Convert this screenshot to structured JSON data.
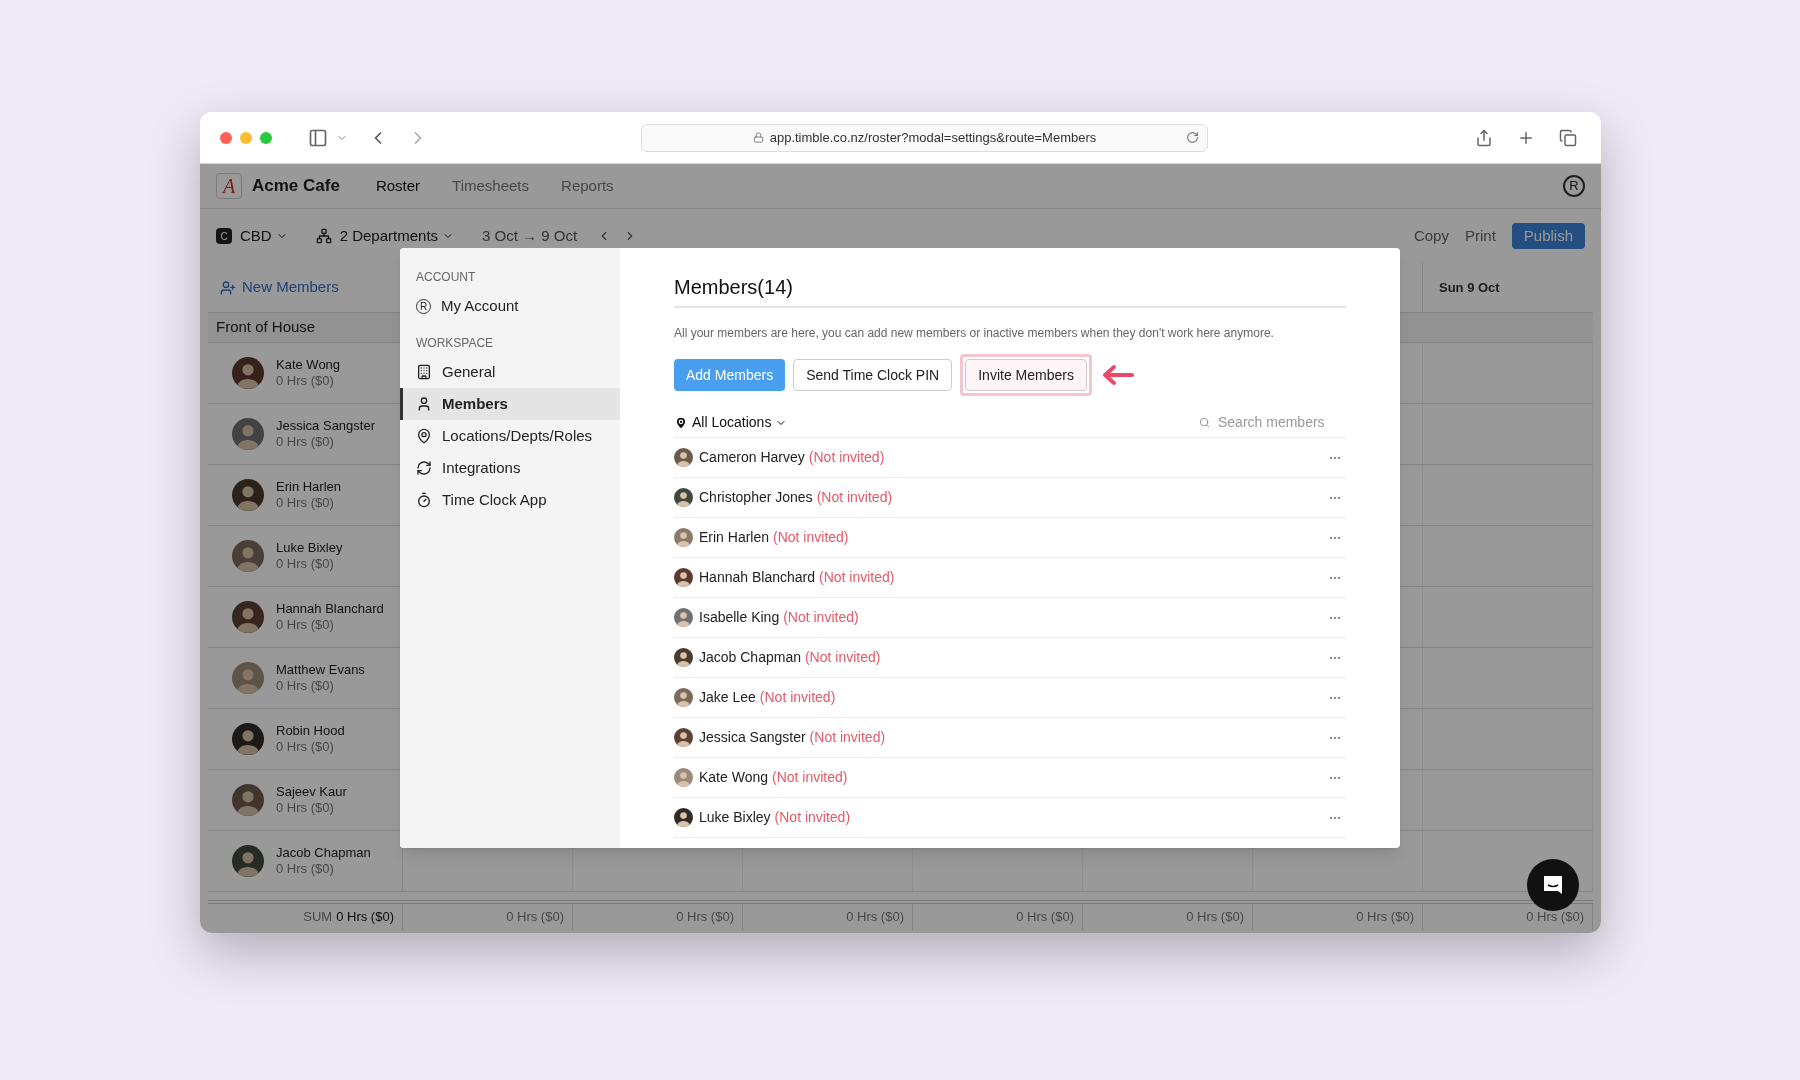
{
  "browser": {
    "url": "app.timble.co.nz/roster?modal=settings&route=Members"
  },
  "app": {
    "logo_letter": "A",
    "name": "Acme Cafe",
    "user_letter": "R",
    "nav": [
      {
        "label": "Roster",
        "selected": true
      },
      {
        "label": "Timesheets",
        "selected": false
      },
      {
        "label": "Reports",
        "selected": false
      }
    ]
  },
  "toolbar": {
    "location_badge": "C",
    "location": "CBD",
    "departments": "2 Departments",
    "date_range": "3 Oct → 9 Oct",
    "actions": [
      {
        "label": "Copy",
        "kind": "plain"
      },
      {
        "label": "Print",
        "kind": "plain"
      },
      {
        "label": "Publish",
        "kind": "primary"
      }
    ]
  },
  "roster": {
    "new_members": "New Members",
    "day_header": "Sun 9 Oct",
    "group": "Front of House",
    "employees": [
      {
        "name": "Kate Wong",
        "hours": "0 Hrs ($0)"
      },
      {
        "name": "Jessica Sangster",
        "hours": "0 Hrs ($0)"
      },
      {
        "name": "Erin Harlen",
        "hours": "0 Hrs ($0)"
      },
      {
        "name": "Luke Bixley",
        "hours": "0 Hrs ($0)"
      },
      {
        "name": "Hannah Blanchard",
        "hours": "0 Hrs ($0)"
      },
      {
        "name": "Matthew Evans",
        "hours": "0 Hrs ($0)"
      },
      {
        "name": "Robin Hood",
        "hours": "0 Hrs ($0)"
      },
      {
        "name": "Sajeev Kaur",
        "hours": "0 Hrs ($0)"
      },
      {
        "name": "Jacob Chapman",
        "hours": "0 Hrs ($0)"
      }
    ],
    "sum_label": "SUM",
    "sum_total": "0 Hrs ($0)",
    "day_totals": [
      "0 Hrs ($0)",
      "0 Hrs ($0)",
      "0 Hrs ($0)",
      "0 Hrs ($0)",
      "0 Hrs ($0)",
      "0 Hrs ($0)",
      "0 Hrs ($0)"
    ]
  },
  "modal": {
    "sidebar": [
      {
        "heading": "ACCOUNT",
        "items": [
          {
            "label": "My Account",
            "letter": "R",
            "selected": false
          }
        ]
      },
      {
        "heading": "WORKSPACE",
        "items": [
          {
            "label": "General",
            "selected": false
          },
          {
            "label": "Members",
            "selected": true
          },
          {
            "label": "Locations/Depts/Roles",
            "selected": false
          },
          {
            "label": "Integrations",
            "selected": false
          },
          {
            "label": "Time Clock App",
            "selected": false
          }
        ]
      }
    ],
    "title": "Members(14)",
    "description": "All your members are here, you can add new members or inactive members when they don't work here anymore.",
    "buttons": [
      {
        "label": "Add Members",
        "kind": "primary",
        "highlighted": false
      },
      {
        "label": "Send Time Clock PIN",
        "kind": "outline",
        "highlighted": false
      },
      {
        "label": "Invite Members",
        "kind": "outline",
        "highlighted": true
      }
    ],
    "filter": "All Locations",
    "search": {
      "placeholder": "Search members"
    },
    "members": [
      {
        "name": "Cameron Harvey",
        "status": "(Not invited)"
      },
      {
        "name": "Christopher Jones",
        "status": "(Not invited)"
      },
      {
        "name": "Erin Harlen",
        "status": "(Not invited)"
      },
      {
        "name": "Hannah Blanchard",
        "status": "(Not invited)"
      },
      {
        "name": "Isabelle King",
        "status": "(Not invited)"
      },
      {
        "name": "Jacob Chapman",
        "status": "(Not invited)"
      },
      {
        "name": "Jake Lee",
        "status": "(Not invited)"
      },
      {
        "name": "Jessica Sangster",
        "status": "(Not invited)"
      },
      {
        "name": "Kate Wong",
        "status": "(Not invited)"
      },
      {
        "name": "Luke Bixley",
        "status": "(Not invited)"
      }
    ]
  }
}
